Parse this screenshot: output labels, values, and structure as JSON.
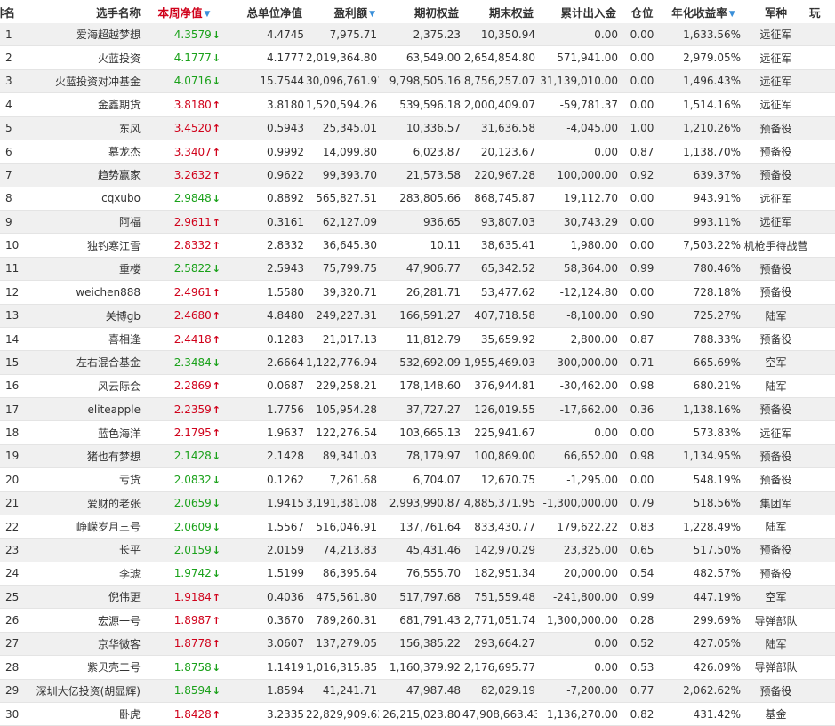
{
  "headers": {
    "rank": "排名",
    "name": "选手名称",
    "week_nav": "本周净值",
    "total_nav": "总单位净值",
    "profit": "盈利额",
    "start_equity": "期初权益",
    "end_equity": "期末权益",
    "cumulative_flow": "累计出入金",
    "position": "仓位",
    "annual_return": "年化收益率",
    "division": "军种",
    "extra": "玩"
  },
  "colors": {
    "up": "#d0021b",
    "down": "#1aa11a",
    "sort_icon": "#3a8fd9"
  },
  "rows": [
    {
      "rank": "1",
      "name": "爱海超越梦想",
      "week": "4.3579",
      "dir": "down",
      "total": "4.4745",
      "profit": "7,975.71",
      "start": "2,375.23",
      "end": "10,350.94",
      "flow": "0.00",
      "pos": "0.00",
      "annual": "1,633.56%",
      "division": "远征军"
    },
    {
      "rank": "2",
      "name": "火蓝投资",
      "week": "4.1777",
      "dir": "down",
      "total": "4.1777",
      "profit": "2,019,364.80",
      "start": "63,549.00",
      "end": "2,654,854.80",
      "flow": "571,941.00",
      "pos": "0.00",
      "annual": "2,979.05%",
      "division": "远征军"
    },
    {
      "rank": "3",
      "name": "火蓝投资对冲基金",
      "week": "4.0716",
      "dir": "down",
      "total": "15.7544",
      "profit": "30,096,761.91",
      "start": "9,798,505.16",
      "end": "8,756,257.07",
      "flow": "31,139,010.00",
      "pos": "0.00",
      "annual": "1,496.43%",
      "division": "远征军"
    },
    {
      "rank": "4",
      "name": "金鑫期货",
      "week": "3.8180",
      "dir": "up",
      "total": "3.8180",
      "profit": "1,520,594.26",
      "start": "539,596.18",
      "end": "2,000,409.07",
      "flow": "-59,781.37",
      "pos": "0.00",
      "annual": "1,514.16%",
      "division": "远征军"
    },
    {
      "rank": "5",
      "name": "东风",
      "week": "3.4520",
      "dir": "up",
      "total": "0.5943",
      "profit": "25,345.01",
      "start": "10,336.57",
      "end": "31,636.58",
      "flow": "-4,045.00",
      "pos": "1.00",
      "annual": "1,210.26%",
      "division": "预备役"
    },
    {
      "rank": "6",
      "name": "慕龙杰",
      "week": "3.3407",
      "dir": "up",
      "total": "0.9992",
      "profit": "14,099.80",
      "start": "6,023.87",
      "end": "20,123.67",
      "flow": "0.00",
      "pos": "0.87",
      "annual": "1,138.70%",
      "division": "预备役"
    },
    {
      "rank": "7",
      "name": "趋势赢家",
      "week": "3.2632",
      "dir": "up",
      "total": "0.9622",
      "profit": "99,393.70",
      "start": "21,573.58",
      "end": "220,967.28",
      "flow": "100,000.00",
      "pos": "0.92",
      "annual": "639.37%",
      "division": "预备役"
    },
    {
      "rank": "8",
      "name": "cqxubo",
      "week": "2.9848",
      "dir": "down",
      "total": "0.8892",
      "profit": "565,827.51",
      "start": "283,805.66",
      "end": "868,745.87",
      "flow": "19,112.70",
      "pos": "0.00",
      "annual": "943.91%",
      "division": "远征军"
    },
    {
      "rank": "9",
      "name": "阿福",
      "week": "2.9611",
      "dir": "up",
      "total": "0.3161",
      "profit": "62,127.09",
      "start": "936.65",
      "end": "93,807.03",
      "flow": "30,743.29",
      "pos": "0.00",
      "annual": "993.11%",
      "division": "远征军"
    },
    {
      "rank": "10",
      "name": "独钓寒江雪",
      "week": "2.8332",
      "dir": "up",
      "total": "2.8332",
      "profit": "36,645.30",
      "start": "10.11",
      "end": "38,635.41",
      "flow": "1,980.00",
      "pos": "0.00",
      "annual": "7,503.22%",
      "division": "机枪手待战营"
    },
    {
      "rank": "11",
      "name": "重楼",
      "week": "2.5822",
      "dir": "down",
      "total": "2.5943",
      "profit": "75,799.75",
      "start": "47,906.77",
      "end": "65,342.52",
      "flow": "58,364.00",
      "pos": "0.99",
      "annual": "780.46%",
      "division": "预备役"
    },
    {
      "rank": "12",
      "name": "weichen888",
      "week": "2.4961",
      "dir": "up",
      "total": "1.5580",
      "profit": "39,320.71",
      "start": "26,281.71",
      "end": "53,477.62",
      "flow": "-12,124.80",
      "pos": "0.00",
      "annual": "728.18%",
      "division": "预备役"
    },
    {
      "rank": "13",
      "name": "关博gb",
      "week": "2.4680",
      "dir": "up",
      "total": "4.8480",
      "profit": "249,227.31",
      "start": "166,591.27",
      "end": "407,718.58",
      "flow": "-8,100.00",
      "pos": "0.90",
      "annual": "725.27%",
      "division": "陆军"
    },
    {
      "rank": "14",
      "name": "喜相逢",
      "week": "2.4418",
      "dir": "up",
      "total": "0.1283",
      "profit": "21,017.13",
      "start": "11,812.79",
      "end": "35,659.92",
      "flow": "2,800.00",
      "pos": "0.87",
      "annual": "788.33%",
      "division": "预备役"
    },
    {
      "rank": "15",
      "name": "左右混合基金",
      "week": "2.3484",
      "dir": "down",
      "total": "2.6664",
      "profit": "1,122,776.94",
      "start": "532,692.09",
      "end": "1,955,469.03",
      "flow": "300,000.00",
      "pos": "0.71",
      "annual": "665.69%",
      "division": "空军"
    },
    {
      "rank": "16",
      "name": "风云际会",
      "week": "2.2869",
      "dir": "up",
      "total": "0.0687",
      "profit": "229,258.21",
      "start": "178,148.60",
      "end": "376,944.81",
      "flow": "-30,462.00",
      "pos": "0.98",
      "annual": "680.21%",
      "division": "陆军"
    },
    {
      "rank": "17",
      "name": "eliteapple",
      "week": "2.2359",
      "dir": "up",
      "total": "1.7756",
      "profit": "105,954.28",
      "start": "37,727.27",
      "end": "126,019.55",
      "flow": "-17,662.00",
      "pos": "0.36",
      "annual": "1,138.16%",
      "division": "预备役"
    },
    {
      "rank": "18",
      "name": "蓝色海洋",
      "week": "2.1795",
      "dir": "up",
      "total": "1.9637",
      "profit": "122,276.54",
      "start": "103,665.13",
      "end": "225,941.67",
      "flow": "0.00",
      "pos": "0.00",
      "annual": "573.83%",
      "division": "远征军"
    },
    {
      "rank": "19",
      "name": "猪也有梦想",
      "week": "2.1428",
      "dir": "down",
      "total": "2.1428",
      "profit": "89,341.03",
      "start": "78,179.97",
      "end": "100,869.00",
      "flow": "66,652.00",
      "pos": "0.98",
      "annual": "1,134.95%",
      "division": "预备役"
    },
    {
      "rank": "20",
      "name": "亏货",
      "week": "2.0832",
      "dir": "down",
      "total": "0.1262",
      "profit": "7,261.68",
      "start": "6,704.07",
      "end": "12,670.75",
      "flow": "-1,295.00",
      "pos": "0.00",
      "annual": "548.19%",
      "division": "预备役"
    },
    {
      "rank": "21",
      "name": "爱财的老张",
      "week": "2.0659",
      "dir": "down",
      "total": "1.9415",
      "profit": "3,191,381.08",
      "start": "2,993,990.87",
      "end": "4,885,371.95",
      "flow": "-1,300,000.00",
      "pos": "0.79",
      "annual": "518.56%",
      "division": "集团军"
    },
    {
      "rank": "22",
      "name": "峥嵘岁月三号",
      "week": "2.0609",
      "dir": "down",
      "total": "1.5567",
      "profit": "516,046.91",
      "start": "137,761.64",
      "end": "833,430.77",
      "flow": "179,622.22",
      "pos": "0.83",
      "annual": "1,228.49%",
      "division": "陆军"
    },
    {
      "rank": "23",
      "name": "长平",
      "week": "2.0159",
      "dir": "down",
      "total": "2.0159",
      "profit": "74,213.83",
      "start": "45,431.46",
      "end": "142,970.29",
      "flow": "23,325.00",
      "pos": "0.65",
      "annual": "517.50%",
      "division": "预备役"
    },
    {
      "rank": "24",
      "name": "李琥",
      "week": "1.9742",
      "dir": "down",
      "total": "1.5199",
      "profit": "86,395.64",
      "start": "76,555.70",
      "end": "182,951.34",
      "flow": "20,000.00",
      "pos": "0.54",
      "annual": "482.57%",
      "division": "预备役"
    },
    {
      "rank": "25",
      "name": "倪伟更",
      "week": "1.9184",
      "dir": "up",
      "total": "0.4036",
      "profit": "475,561.80",
      "start": "517,797.68",
      "end": "751,559.48",
      "flow": "-241,800.00",
      "pos": "0.99",
      "annual": "447.19%",
      "division": "空军"
    },
    {
      "rank": "26",
      "name": "宏源一号",
      "week": "1.8987",
      "dir": "up",
      "total": "0.3670",
      "profit": "789,260.31",
      "start": "681,791.43",
      "end": "2,771,051.74",
      "flow": "1,300,000.00",
      "pos": "0.28",
      "annual": "299.69%",
      "division": "导弹部队"
    },
    {
      "rank": "27",
      "name": "京华微客",
      "week": "1.8778",
      "dir": "up",
      "total": "3.0607",
      "profit": "137,279.05",
      "start": "156,385.22",
      "end": "293,664.27",
      "flow": "0.00",
      "pos": "0.52",
      "annual": "427.05%",
      "division": "陆军"
    },
    {
      "rank": "28",
      "name": "紫贝壳二号",
      "week": "1.8758",
      "dir": "down",
      "total": "1.1419",
      "profit": "1,016,315.85",
      "start": "1,160,379.92",
      "end": "2,176,695.77",
      "flow": "0.00",
      "pos": "0.53",
      "annual": "426.09%",
      "division": "导弹部队"
    },
    {
      "rank": "29",
      "name": "深圳大亿投资(胡显辉)",
      "week": "1.8594",
      "dir": "down",
      "total": "1.8594",
      "profit": "41,241.71",
      "start": "47,987.48",
      "end": "82,029.19",
      "flow": "-7,200.00",
      "pos": "0.77",
      "annual": "2,062.62%",
      "division": "预备役"
    },
    {
      "rank": "30",
      "name": "卧虎",
      "week": "1.8428",
      "dir": "up",
      "total": "3.2335",
      "profit": "22,829,909.63",
      "start": "26,215,023.80",
      "end": "47,908,663.43",
      "flow": "1,136,270.00",
      "pos": "0.82",
      "annual": "431.42%",
      "division": "基金"
    }
  ]
}
